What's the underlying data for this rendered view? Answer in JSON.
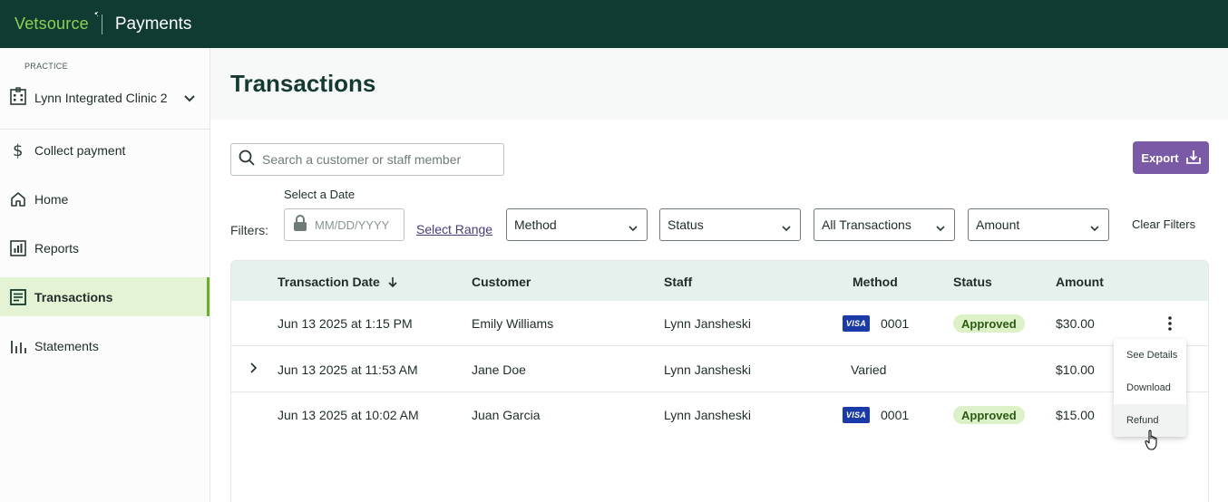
{
  "app": {
    "brand": "Vetsource",
    "product": "Payments",
    "colors": {
      "topbar": "#0f3b32",
      "brand_green": "#8fd14f",
      "accent_purple": "#7a5aa6",
      "active_nav": "#e4f3d3"
    }
  },
  "sidebar": {
    "practice_label": "PRACTICE",
    "practice_name": "Lynn Integrated Clinic 2",
    "items": [
      {
        "label": "Collect payment",
        "icon": "dollar-icon",
        "active": false
      },
      {
        "label": "Home",
        "icon": "home-icon",
        "active": false
      },
      {
        "label": "Reports",
        "icon": "reports-icon",
        "active": false
      },
      {
        "label": "Transactions",
        "icon": "receipt-icon",
        "active": true
      },
      {
        "label": "Statements",
        "icon": "bar-chart-icon",
        "active": false
      }
    ]
  },
  "page": {
    "title": "Transactions",
    "search_placeholder": "Search a customer or staff member",
    "export_label": "Export"
  },
  "filters": {
    "label": "Filters:",
    "date_label": "Select a Date",
    "date_placeholder": "MM/DD/YYYY",
    "select_range": "Select Range",
    "method": "Method",
    "status": "Status",
    "transactions": "All Transactions",
    "amount": "Amount",
    "clear": "Clear Filters"
  },
  "table": {
    "headers": {
      "date": "Transaction Date",
      "customer": "Customer",
      "staff": "Staff",
      "method": "Method",
      "status": "Status",
      "amount": "Amount"
    },
    "sort": "descending",
    "rows": [
      {
        "date": "Jun 13 2025 at 1:15 PM",
        "customer": "Emily Williams",
        "staff": "Lynn Jansheski",
        "card": "VISA",
        "last4": "0001",
        "method_text": "",
        "status": "Approved",
        "amount": "$30.00",
        "expandable": false
      },
      {
        "date": "Jun 13 2025 at 11:53 AM",
        "customer": "Jane Doe",
        "staff": "Lynn Jansheski",
        "card": "",
        "last4": "",
        "method_text": "Varied",
        "status": "",
        "amount": "$10.00",
        "expandable": true
      },
      {
        "date": "Jun 13 2025 at 10:02 AM",
        "customer": "Juan Garcia",
        "staff": "Lynn Jansheski",
        "card": "VISA",
        "last4": "0001",
        "method_text": "",
        "status": "Approved",
        "amount": "$15.00",
        "expandable": false
      }
    ]
  },
  "row_menu": {
    "items": [
      "See Details",
      "Download",
      "Refund"
    ],
    "hovered": "Refund"
  }
}
